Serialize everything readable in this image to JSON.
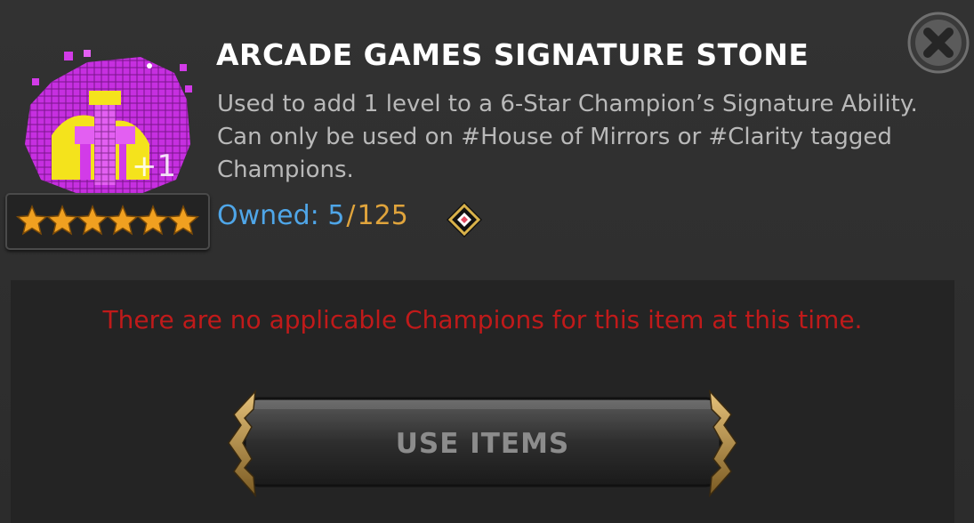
{
  "item": {
    "title": "ARCADE GAMES SIGNATURE STONE",
    "description": "Used to add 1 level to a 6-Star Champion’s Signature Ability. Can only be used on #House of Mirrors or #Clarity tagged Champions.",
    "icon": "pixel-signature-stone-icon",
    "icon_badge": "+1",
    "star_rating": 6,
    "colors": {
      "magenta": "#d23be8",
      "yellow": "#f4e31c",
      "star": "#f0a020"
    }
  },
  "owned": {
    "label": "Owned: ",
    "count": "5",
    "separator": "/",
    "max": "125",
    "colors": {
      "label": "#4fa6e8",
      "max": "#e0a43c"
    }
  },
  "notice": {
    "text": "There are no applicable Champions for this item at this time.",
    "color": "#c01a1a"
  },
  "actions": {
    "use_label": "USE ITEMS",
    "close_icon": "close-icon"
  }
}
